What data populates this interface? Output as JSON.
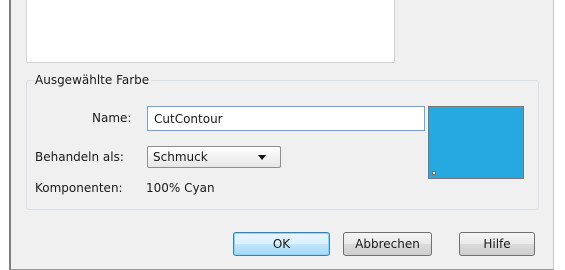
{
  "selected_color_group": {
    "legend": "Ausgewählte Farbe",
    "name_label": "Name:",
    "name_value": "CutContour",
    "treat_as_label": "Behandeln als:",
    "treat_as_value": "Schmuck",
    "components_label": "Komponenten:",
    "components_value": "100% Cyan",
    "swatch_color": "#26a9e1"
  },
  "buttons": {
    "ok": "OK",
    "cancel": "Abbrechen",
    "help": "Hilfe"
  },
  "icons": {
    "dropdown": "chevron-down-icon"
  },
  "colors": {
    "dialog_background": "#f0f0f0",
    "ok_button_border": "#3c7fb1"
  }
}
